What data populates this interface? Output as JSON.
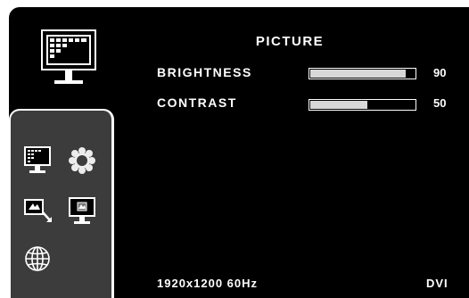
{
  "menu": {
    "title": "PICTURE",
    "header_icon": "monitor-picture-icon",
    "items": [
      {
        "label": "BRIGHTNESS",
        "value": "90",
        "level_percent": 90
      },
      {
        "label": "CONTRAST",
        "value": "50",
        "level_percent": 50
      }
    ]
  },
  "sidebar": {
    "icons": [
      {
        "name": "picture-menu-icon",
        "selected": true
      },
      {
        "name": "color-settings-icon",
        "selected": false
      },
      {
        "name": "input-source-icon",
        "selected": false
      },
      {
        "name": "display-position-icon",
        "selected": false
      },
      {
        "name": "language-globe-icon",
        "selected": false
      }
    ]
  },
  "status": {
    "resolution": "1920x1200 60Hz",
    "input": "DVI"
  },
  "colors": {
    "background": "#000000",
    "sidebar": "#3c3c3c",
    "bar_fill": "#d8d8d8",
    "text": "#ffffff"
  }
}
